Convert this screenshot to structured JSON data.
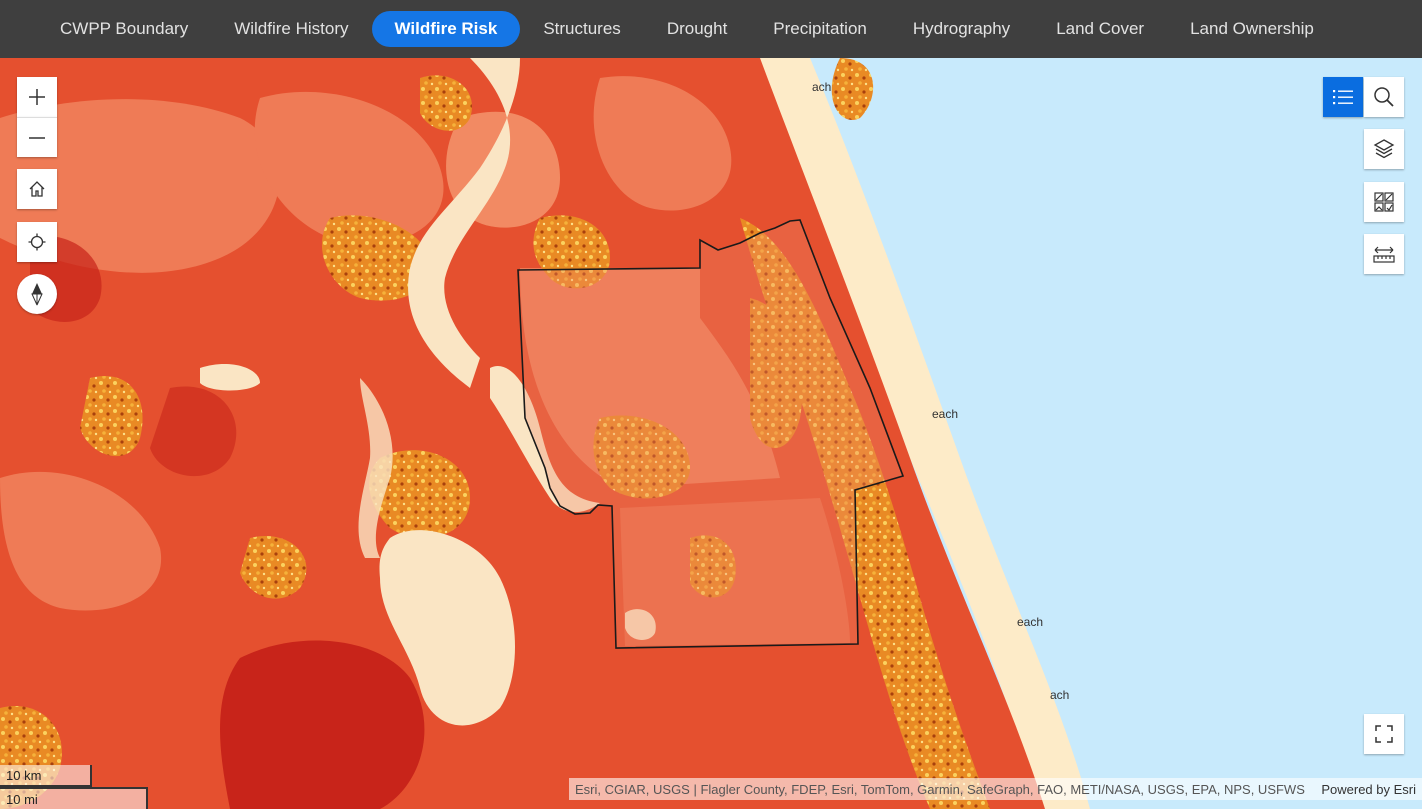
{
  "tabs": [
    {
      "label": "CWPP Boundary",
      "active": false
    },
    {
      "label": "Wildfire History",
      "active": false
    },
    {
      "label": "Wildfire Risk",
      "active": true
    },
    {
      "label": "Structures",
      "active": false
    },
    {
      "label": "Drought",
      "active": false
    },
    {
      "label": "Precipitation",
      "active": false
    },
    {
      "label": "Hydrography",
      "active": false
    },
    {
      "label": "Land Cover",
      "active": false
    },
    {
      "label": "Land Ownership",
      "active": false
    }
  ],
  "map": {
    "place_labels": [
      "ach",
      "each",
      "each",
      "ach"
    ],
    "scale": {
      "km": "10 km",
      "mi": "10 mi"
    },
    "attribution": "Esri, CGIAR, USGS | Flagler County, FDEP, Esri, TomTom, Garmin, SafeGraph, FAO, METI/NASA, USGS, EPA, NPS, USFWS",
    "powered_by": "Powered by Esri"
  },
  "controls": {
    "zoom_in": "zoom-in-icon",
    "zoom_out": "zoom-out-icon",
    "home": "home-icon",
    "locate": "locate-icon",
    "compass": "compass-icon",
    "legend": "legend-list-icon",
    "search": "search-icon",
    "layers": "layers-icon",
    "basemap": "basemap-gallery-icon",
    "measure": "measure-icon",
    "fullscreen": "fullscreen-icon"
  },
  "colors": {
    "tabbar_bg": "#3f3f3f",
    "tab_active": "#1576e6",
    "ocean": "#c8eafc",
    "beach": "#fdebc8",
    "risk_high": "#e34b2e",
    "risk_moderate": "#ef7a55",
    "risk_very_high": "#c8241a",
    "risk_low": "#f5c88a",
    "speckle": "#e8901e"
  }
}
